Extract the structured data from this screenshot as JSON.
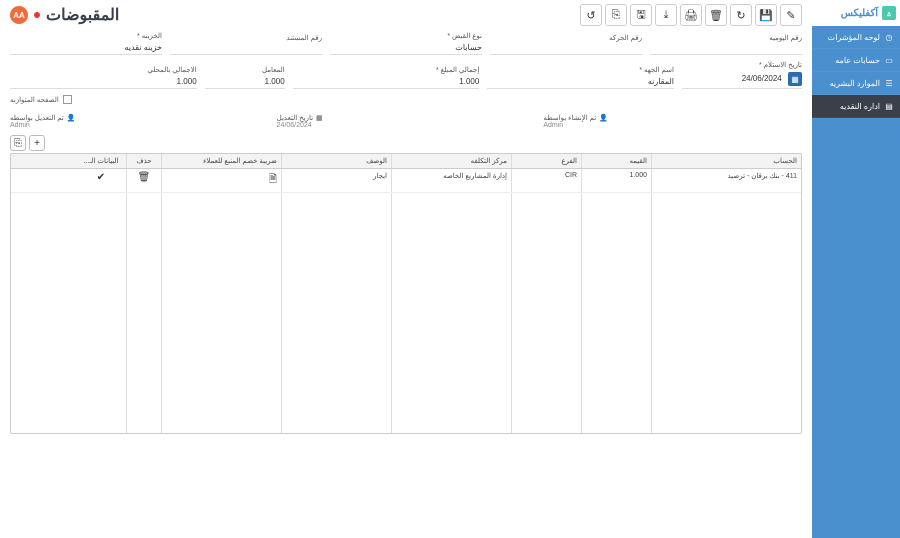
{
  "brand": {
    "name": "آكفليكس"
  },
  "sidebar": {
    "items": [
      {
        "label": "لوحه المؤشرات"
      },
      {
        "label": "حسابات عامه"
      },
      {
        "label": "الموارد البشريه"
      },
      {
        "label": "اداره النقديه"
      }
    ]
  },
  "page": {
    "title": "المقبوضات",
    "badge": "AA"
  },
  "toolbar": {
    "edit": "✎",
    "save": "🖫",
    "refresh": "↻",
    "trash": "🗑",
    "print": "🖨",
    "download": "⤓",
    "savealt": "🖫",
    "export": "⎘",
    "history": "↺"
  },
  "form": {
    "row1": {
      "daily_no": {
        "label": "رقم اليوميه",
        "value": ""
      },
      "trans_no": {
        "label": "رقم الحركه",
        "value": ""
      },
      "receipt_type": {
        "label": "نوع القبض *",
        "value": "حسابات"
      },
      "doc_no": {
        "label": "رقم المستند",
        "value": ""
      },
      "treasury": {
        "label": "الخزينه *",
        "value": "خزينه نقديه"
      }
    },
    "row2": {
      "receive_date": {
        "label": "تاريخ الاستلام *",
        "value": "24/06/2024"
      },
      "party_name": {
        "label": "اسم الجهه *",
        "value": "المقارنه"
      },
      "total_amount": {
        "label": "إجمالي المبلغ *",
        "value": "1.000"
      },
      "factor": {
        "label": "المعامل",
        "value": "1.000"
      },
      "local_total": {
        "label": "الاجمالي بالمحلي",
        "value": "1.000"
      }
    },
    "row3": {
      "balanced_label": "الصفحه المتوازنه"
    }
  },
  "audit": {
    "created_by": {
      "label": "تم الإنشاء بواسطه",
      "value": "Admin"
    },
    "modified_date": {
      "label": "تاريخ التعديل",
      "value": "24/06/2024"
    },
    "modified_by": {
      "label": "تم التعديل بواسطه",
      "value": "Admin"
    }
  },
  "grid": {
    "headers": {
      "account": "الحساب",
      "amount": "القيمه",
      "branch": "الفرع",
      "cost_center": "مركز التكلفه",
      "desc": "الوصف",
      "tax": "ضريبة خصم المنبع للعملاء",
      "delete": "حذف",
      "more": "البيانات الـ..."
    },
    "rows": [
      {
        "account": "411 - بنك برقان - ترصيد",
        "amount": "1.000",
        "branch": "CIR",
        "cost_center": "إدارة المشاريع الخاصه",
        "desc": "ايجار",
        "tax": ""
      }
    ]
  }
}
